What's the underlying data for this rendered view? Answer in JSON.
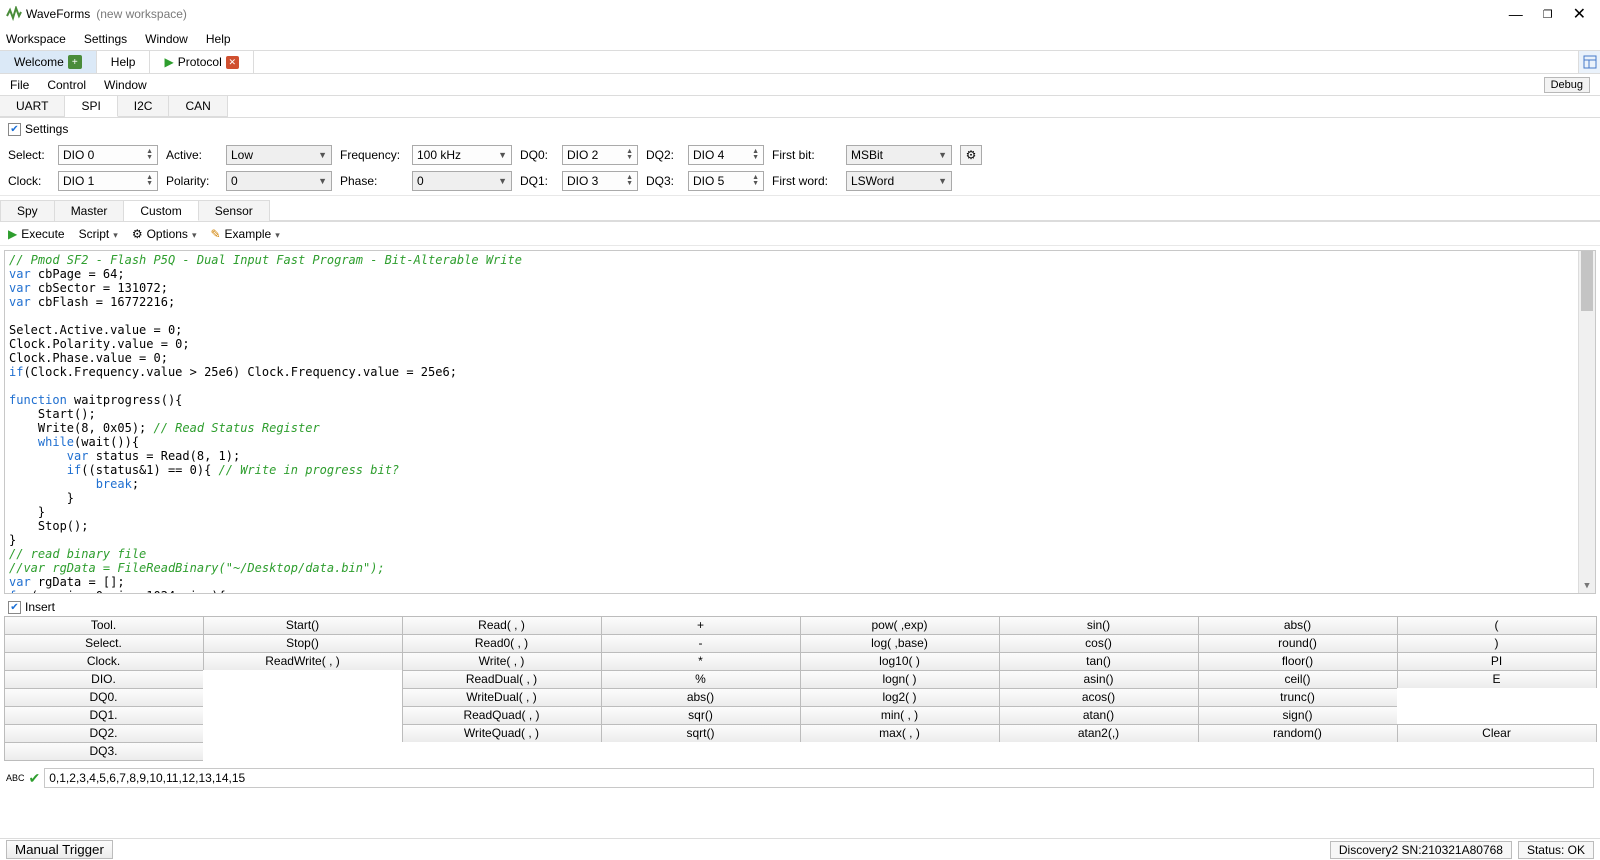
{
  "window": {
    "app_name": "WaveForms",
    "workspace": "(new workspace)"
  },
  "menubar": [
    "Workspace",
    "Settings",
    "Window",
    "Help"
  ],
  "top_tabs": {
    "welcome": "Welcome",
    "help": "Help",
    "protocol": "Protocol"
  },
  "sub_menubar": [
    "File",
    "Control",
    "Window"
  ],
  "debug_btn": "Debug",
  "proto_tabs": [
    "UART",
    "SPI",
    "I2C",
    "CAN"
  ],
  "settings_label": "Settings",
  "cfg": {
    "labels": {
      "select": "Select:",
      "active": "Active:",
      "frequency": "Frequency:",
      "dq0": "DQ0:",
      "dq2": "DQ2:",
      "firstbit": "First bit:",
      "clock": "Clock:",
      "polarity": "Polarity:",
      "phase": "Phase:",
      "dq1": "DQ1:",
      "dq3": "DQ3:",
      "firstword": "First word:"
    },
    "values": {
      "select": "DIO 0",
      "active": "Low",
      "frequency": "100 kHz",
      "dq0": "DIO 2",
      "dq2": "DIO 4",
      "firstbit": "MSBit",
      "clock": "DIO 1",
      "polarity": "0",
      "phase": "0",
      "dq1": "DIO 3",
      "dq3": "DIO 5",
      "firstword": "LSWord"
    }
  },
  "mode_tabs": [
    "Spy",
    "Master",
    "Custom",
    "Sensor"
  ],
  "toolbar2": {
    "execute": "Execute",
    "script": "Script",
    "options": "Options",
    "example": "Example"
  },
  "insert_label": "Insert",
  "fn_grid": {
    "r0": [
      "Tool.",
      "Start()",
      "Read( , )",
      "+",
      "pow( ,exp)",
      "sin()",
      "abs()",
      "("
    ],
    "r1": [
      "Select.",
      "Stop()",
      "Read0( , )",
      "-",
      "log( ,base)",
      "cos()",
      "round()",
      ")"
    ],
    "r2": [
      "Clock.",
      "ReadWrite( , )",
      "Write( , )",
      "*",
      "log10( )",
      "tan()",
      "floor()",
      "PI"
    ],
    "r3": [
      "DIO.",
      "",
      "ReadDual( , )",
      "%",
      "logn( )",
      "asin()",
      "ceil()",
      "E"
    ],
    "r4": [
      "DQ0.",
      "",
      "WriteDual( , )",
      "abs()",
      "log2( )",
      "acos()",
      "trunc()",
      ""
    ],
    "r5": [
      "DQ1.",
      "",
      "ReadQuad( , )",
      "sqr()",
      "min( , )",
      "atan()",
      "sign()",
      ""
    ],
    "r6": [
      "DQ2.",
      "",
      "WriteQuad( , )",
      "sqrt()",
      "max( , )",
      "atan2(,)",
      "random()",
      "Clear"
    ],
    "r7": [
      "DQ3.",
      "",
      "",
      "",
      "",
      "",
      "",
      ""
    ]
  },
  "bottom_text": "0,1,2,3,4,5,6,7,8,9,10,11,12,13,14,15",
  "statusbar": {
    "manual_trigger": "Manual Trigger",
    "device": "Discovery2 SN:210321A80768",
    "status": "Status: OK"
  }
}
